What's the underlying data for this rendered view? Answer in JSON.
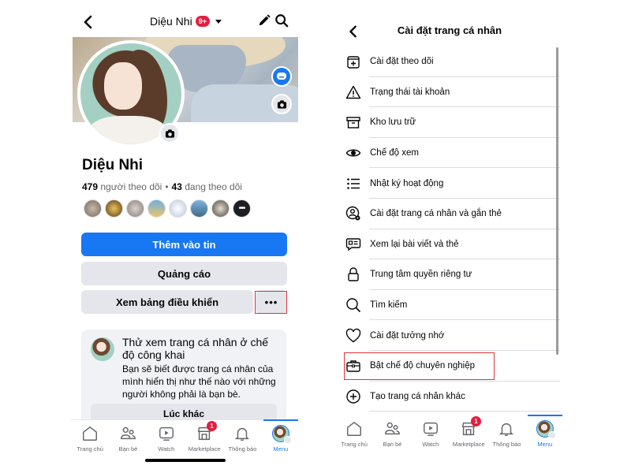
{
  "left": {
    "header": {
      "title": "Diệu Nhi",
      "badge": "9+"
    },
    "profile": {
      "name": "Diệu Nhi",
      "followers_count": "479",
      "followers_label": "người theo dõi",
      "separator": "•",
      "following_count": "43",
      "following_label": "đang theo dõi",
      "friends_more": "•••"
    },
    "buttons": {
      "add_story": "Thêm vào tin",
      "ads": "Quảng cáo",
      "dashboard": "Xem bảng điều khiển",
      "more": "•••"
    },
    "card": {
      "title": "Thử xem trang cá nhân ở chế độ công khai",
      "body": "Bạn sẽ biết được trang cá nhân của mình hiển thị như thế nào với những người không phải là bạn bè.",
      "button": "Lúc khác"
    }
  },
  "right": {
    "header": {
      "title": "Cài đặt trang cá nhân"
    },
    "menu": [
      {
        "icon": "follow-settings-icon",
        "label": "Cài đặt theo dõi"
      },
      {
        "icon": "warning-icon",
        "label": "Trạng thái tài khoản"
      },
      {
        "icon": "archive-icon",
        "label": "Kho lưu trữ"
      },
      {
        "icon": "eye-icon",
        "label": "Chế độ xem"
      },
      {
        "icon": "list-icon",
        "label": "Nhật ký hoạt động"
      },
      {
        "icon": "profile-gear-icon",
        "label": "Cài đặt trang cá nhân và gắn thẻ"
      },
      {
        "icon": "review-posts-icon",
        "label": "Xem lại bài viết và thẻ"
      },
      {
        "icon": "lock-icon",
        "label": "Trung tâm quyền riêng tư"
      },
      {
        "icon": "search-icon",
        "label": "Tìm kiếm"
      },
      {
        "icon": "heart-icon",
        "label": "Cài đặt tưởng nhớ"
      },
      {
        "icon": "briefcase-icon",
        "label": "Bật chế độ chuyên nghiệp"
      },
      {
        "icon": "plus-circle-icon",
        "label": "Tạo trang cá nhân khác"
      }
    ]
  },
  "bottom_nav": {
    "items": [
      {
        "label": "Trang chủ",
        "icon": "home-icon"
      },
      {
        "label": "Bạn bè",
        "icon": "friends-icon"
      },
      {
        "label": "Watch",
        "icon": "watch-icon"
      },
      {
        "label": "Marketplace",
        "icon": "marketplace-icon",
        "badge": "1"
      },
      {
        "label": "Thông báo",
        "icon": "bell-icon"
      },
      {
        "label": "Menu",
        "icon": "menu-avatar",
        "active": true
      }
    ]
  },
  "colors": {
    "accent": "#1877f2",
    "badge": "#e41e3f",
    "highlight": "#e0343b",
    "button_grey": "#e4e6eb"
  }
}
